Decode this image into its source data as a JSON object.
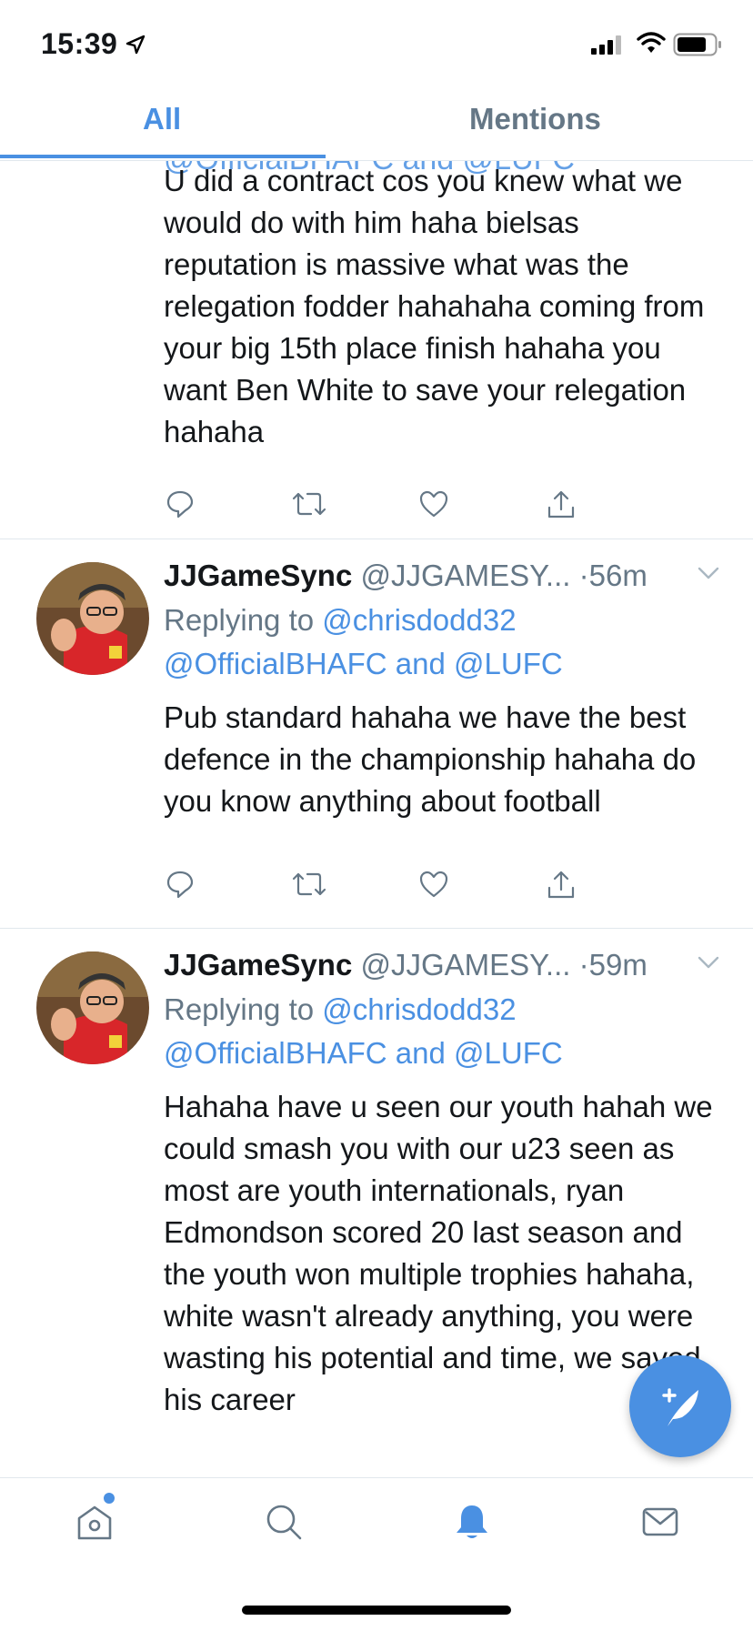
{
  "status_bar": {
    "time": "15:39"
  },
  "tabs": [
    {
      "label": "All",
      "active": true
    },
    {
      "label": "Mentions",
      "active": false
    }
  ],
  "top_tweet": {
    "cut_off_line": "@OfficialBHAFC and @LUFC",
    "text": "U did a contract cos you knew what we would do with him haha bielsas reputation is massive what was the relegation fodder hahahaha coming from your big 15th place finish hahaha you want Ben White to save your relegation hahaha"
  },
  "tweets": [
    {
      "name": "JJGameSync",
      "handle": "@JJGAMESY...",
      "time_ago": "56m",
      "replying_prefix": "Replying to",
      "reply_to_1": "@chrisdodd32",
      "reply_to_2": "@OfficialBHAFC",
      "reply_and": "and",
      "reply_to_3": "@LUFC",
      "text": "Pub standard hahaha we have the best defence in the championship hahaha do you know anything about football"
    },
    {
      "name": "JJGameSync",
      "handle": "@JJGAMESY...",
      "time_ago": "59m",
      "replying_prefix": "Replying to",
      "reply_to_1": "@chrisdodd32",
      "reply_to_2": "@OfficialBHAFC",
      "reply_and": "and",
      "reply_to_3": "@LUFC",
      "text": "Hahaha have u seen our youth hahah we could smash you with our u23 seen as most are youth internationals, ryan Edmondson scored 20 last season and the youth won multiple trophies hahaha, white wasn't already anything, you were wasting his potential and time, we saved his career"
    }
  ],
  "bottom_nav": [
    "home-icon",
    "search-icon",
    "notifications-icon",
    "messages-icon"
  ],
  "colors": {
    "accent": "#4a90e2",
    "secondary_text": "#657786",
    "divider": "#e1e8ed"
  }
}
